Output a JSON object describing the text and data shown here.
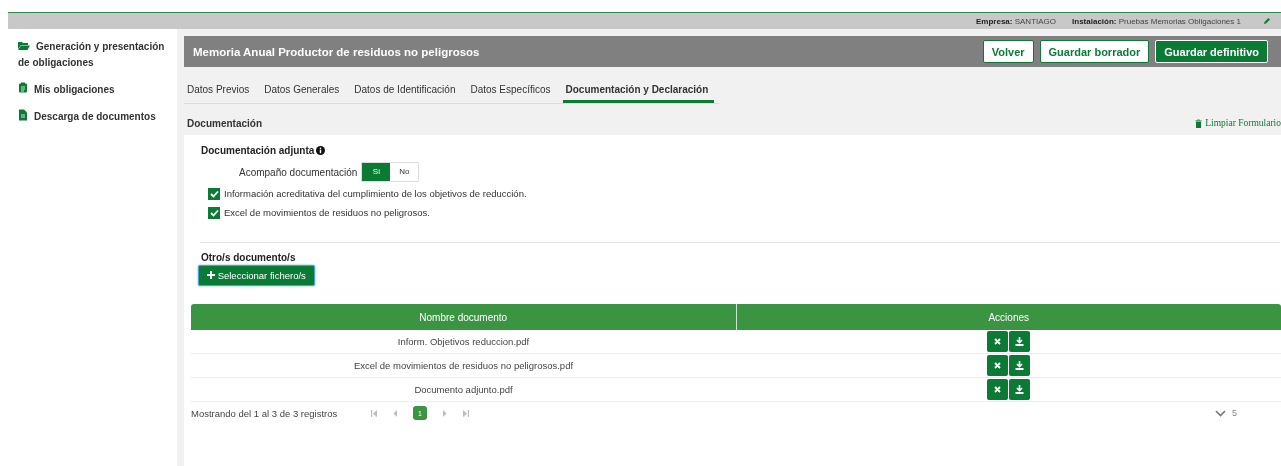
{
  "top_bar": {
    "company_label": "Empresa:",
    "company": "SANTIAGO",
    "installation_label": "Instalación:",
    "installation": "Pruebas Memorias Obligaciones 1"
  },
  "sidebar": {
    "items": [
      {
        "label": "Generación y presentación de obligaciones"
      },
      {
        "label": "Mis obligaciones"
      },
      {
        "label": "Descarga de documentos"
      }
    ]
  },
  "header": {
    "title": "Memoria Anual Productor de residuos no peligrosos",
    "buttons": [
      {
        "label": "Volver",
        "kind": "outline"
      },
      {
        "label": "Guardar borrador",
        "kind": "outline"
      },
      {
        "label": "Guardar definitivo",
        "kind": "primary"
      }
    ]
  },
  "tabs": [
    {
      "label": "Datos Previos",
      "selected": false
    },
    {
      "label": "Datos Generales",
      "selected": false
    },
    {
      "label": "Datos de Identificación",
      "selected": false
    },
    {
      "label": "Datos Específicos",
      "selected": false
    },
    {
      "label": "Documentación y Declaración",
      "selected": true
    }
  ],
  "section": {
    "title": "Documentación",
    "clear_link": "Limpiar Formulario"
  },
  "attached": {
    "title": "Documentación adjunta",
    "toggle_label": "Acompaño documentación",
    "options": [
      {
        "label": "Sí",
        "selected": true
      },
      {
        "label": "No",
        "selected": false
      }
    ],
    "checkboxes": [
      {
        "label": "Información acreditativa del cumplimiento de los objetivos de reducción.",
        "checked": true
      },
      {
        "label": "Excel de movimientos de residuos no peligrosos.",
        "checked": true
      }
    ]
  },
  "other": {
    "title": "Otro/s documento/s",
    "button": "Seleccionar fichero/s"
  },
  "table": {
    "columns": [
      "Nombre documento",
      "Acciones"
    ],
    "rows": [
      {
        "name": "Inform. Objetivos reduccion.pdf"
      },
      {
        "name": "Excel de movimientos de residuos no peligrosos.pdf"
      },
      {
        "name": "Documento adjunto.pdf"
      }
    ]
  },
  "pagination": {
    "summary": "Mostrando del 1 al 3 de 3 registros",
    "pages": [
      {
        "label": "1",
        "selected": true
      }
    ],
    "page_size": "5"
  }
}
